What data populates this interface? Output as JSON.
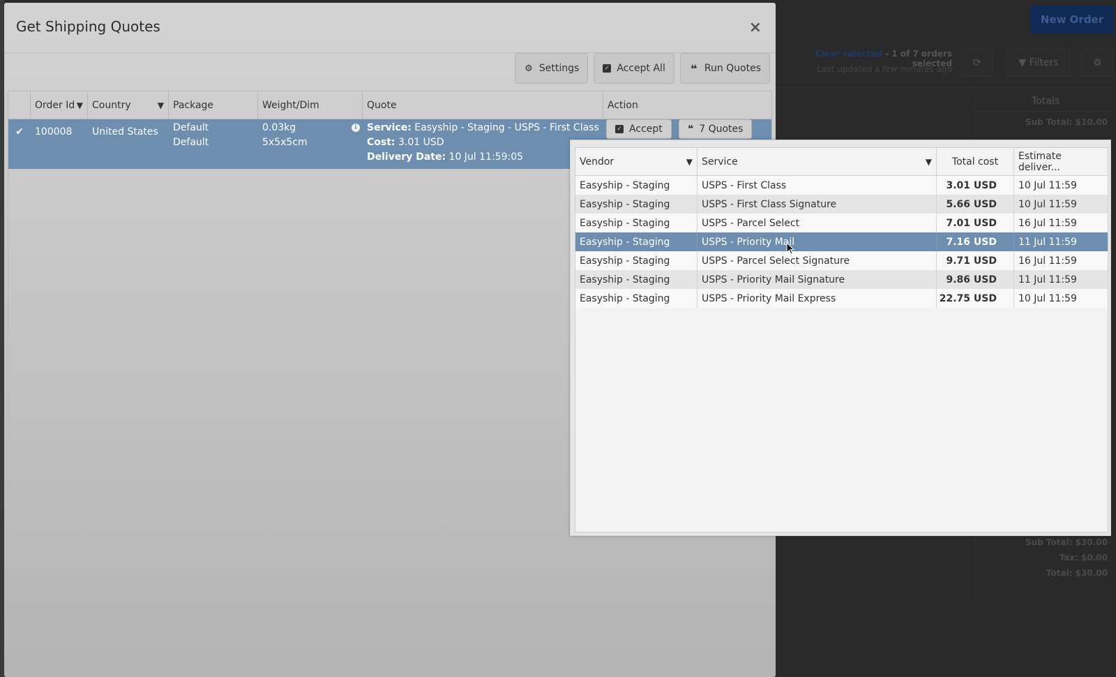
{
  "background": {
    "new_order_label": "New Order",
    "clear_selected": "Clear selected",
    "selection_status": " - 1 of 7 orders selected",
    "last_updated": "Last updated a few minutes ago",
    "filters_label": "Filters",
    "totals_header": "Totals",
    "sub_total_top": "Sub Total: $10.00",
    "sub_total_bottom": "Sub Total: $30.00",
    "tax": "Tax: $0.00",
    "total": "Total: $30.00"
  },
  "modal": {
    "title": "Get Shipping Quotes",
    "close_glyph": "×",
    "toolbar": {
      "settings_label": "Settings",
      "accept_all_label": "Accept All",
      "run_quotes_label": "Run Quotes"
    },
    "columns": {
      "order_id": "Order Id",
      "country": "Country",
      "package": "Package",
      "weight_dim": "Weight/Dim",
      "quote": "Quote",
      "action": "Action"
    },
    "order": {
      "order_id": "100008",
      "country": "United States",
      "package_line1": "Default",
      "package_line2": "Default",
      "weight": "0.03kg",
      "dimensions": "5x5x5cm",
      "service_label": "Service:",
      "service_value": " Easyship - Staging - USPS - First Class",
      "cost_label": "Cost:",
      "cost_value": " 3.01 USD",
      "delivery_label": "Delivery Date:",
      "delivery_value": " 10 Jul 11:59:05",
      "accept_label": "Accept",
      "quotes_label": "7 Quotes"
    }
  },
  "quotes_popup": {
    "columns": {
      "vendor": "Vendor",
      "service": "Service",
      "total_cost": "Total cost",
      "estimate": "Estimate deliver..."
    },
    "rows": [
      {
        "vendor": "Easyship - Staging",
        "service": "USPS - First Class",
        "cost": "3.01 USD",
        "estimate": "10 Jul 11:59"
      },
      {
        "vendor": "Easyship - Staging",
        "service": "USPS - First Class Signature",
        "cost": "5.66 USD",
        "estimate": "10 Jul 11:59"
      },
      {
        "vendor": "Easyship - Staging",
        "service": "USPS - Parcel Select",
        "cost": "7.01 USD",
        "estimate": "16 Jul 11:59"
      },
      {
        "vendor": "Easyship - Staging",
        "service": "USPS - Priority Mail",
        "cost": "7.16 USD",
        "estimate": "11 Jul 11:59"
      },
      {
        "vendor": "Easyship - Staging",
        "service": "USPS - Parcel Select Signature",
        "cost": "9.71 USD",
        "estimate": "16 Jul 11:59"
      },
      {
        "vendor": "Easyship - Staging",
        "service": "USPS - Priority Mail Signature",
        "cost": "9.86 USD",
        "estimate": "11 Jul 11:59"
      },
      {
        "vendor": "Easyship - Staging",
        "service": "USPS - Priority Mail Express",
        "cost": "22.75 USD",
        "estimate": "10 Jul 11:59"
      }
    ],
    "selected_index": 3
  },
  "colors": {
    "selected_row": "#6d8eae",
    "new_order_bg": "#0f2a55"
  }
}
